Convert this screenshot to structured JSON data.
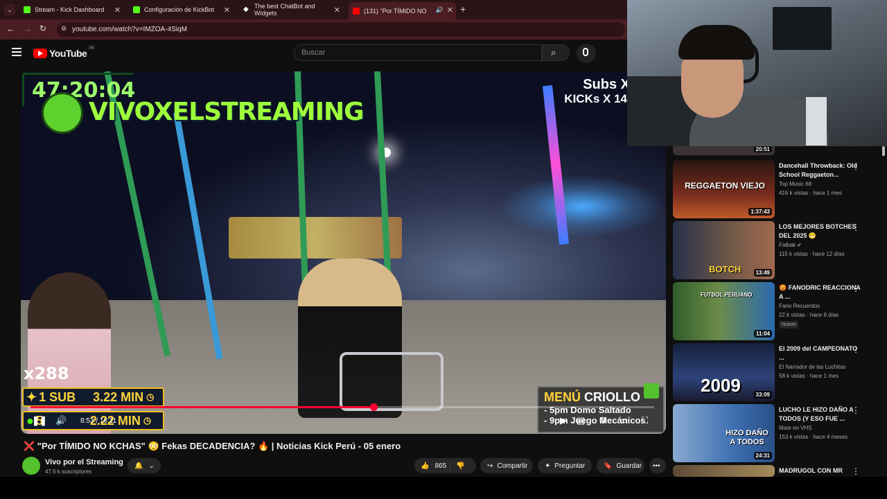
{
  "browser": {
    "tabs": [
      {
        "label": "Stream - Kick Dashboard",
        "icon": "kick-icon",
        "color": "#53fc18"
      },
      {
        "label": "Configuración de KickBot",
        "icon": "kickbot-icon",
        "color": "#53fc18"
      },
      {
        "label": "The best ChatBot and Widgets",
        "icon": "diamond-icon",
        "color": "#ffffff"
      },
      {
        "label": "(131) \"Por TÍMIDO NO",
        "icon": "youtube-icon",
        "color": "#ff0000",
        "active": true
      }
    ],
    "url": "youtube.com/watch?v=IMZOA-4SiqM"
  },
  "youtube": {
    "logo": "YouTube",
    "region": "PE",
    "search_placeholder": "Buscar"
  },
  "video": {
    "overlay_timer": "47:20:04",
    "overlay_channel": "VIVOXELSTREAMING",
    "subs_text": "Subs X",
    "kicks_text": "KICKs X 14",
    "multiplier": "x288",
    "sub_row1_left": "1 SUB",
    "sub_row1_right": "3.22 MIN",
    "sub_row2_left": "5",
    "sub_row2_right": "2.22 MIN",
    "menu_title_a": "MENÚ",
    "menu_title_b": "CRIOLLO",
    "menu_line1": "- 5pm Domo Saltado",
    "menu_line2": "- 9pm Juego Mecánicos",
    "current_time": "8:53",
    "duration": "16:11",
    "progress_fraction": 0.55
  },
  "info": {
    "title": "❌ \"Por TÍMIDO NO KCHAS\" 😳 Fekas DECADENCIA? 🔥 | Noticias Kick Perú - 05 enero",
    "channel": "Vivo por el Streaming",
    "subscribers": "47.5 k suscriptores",
    "likes": "865",
    "share": "Compartir",
    "ask": "Preguntar",
    "save": "Guardar"
  },
  "sidebar": [
    {
      "title": "Dancehall Throwback: Old School Reggaeton...",
      "channel": "Top Music 68",
      "meta": "416 k vistas · hace 1 mes",
      "duration": "1:37:43",
      "thumb_text": "REGGAETON VIEJO",
      "thumb_color": "#3a1b14"
    },
    {
      "title": "LOS MEJORES BOTCHES DEL 2025 😬",
      "channel": "Falbak ✔",
      "meta": "115 k vistas · hace 12 días",
      "duration": "13:49",
      "thumb_text": "BOTCH",
      "thumb_color": "#5c4a3e"
    },
    {
      "title": "😡 FANODRIC REACCIONA A ...",
      "channel": "Fano Recuerdos",
      "meta": "22 k vistas · hace 6 días",
      "duration": "11:04",
      "badge": "Nuevo",
      "thumb_text": "FUTBOL PERUANO",
      "thumb_color": "#3c5c2e"
    },
    {
      "title": "El 2009 del CAMPEONATO ...",
      "channel": "El Narrador de las Luchitas",
      "meta": "58 k vistas · hace 1 mes",
      "duration": "33:09",
      "thumb_text": "2009",
      "thumb_color": "#1f2a4a"
    },
    {
      "title": "LUCHO LE HIZO DAÑO A TODOS (Y ESO FUE ...",
      "channel": "Mate en VHS",
      "meta": "153 k vistas · hace 4 meses",
      "duration": "24:31",
      "thumb_text": "HIZO DAÑO A TODOS",
      "thumb_color": "#3d6fb1"
    },
    {
      "title": "MADRUGOL CON MR",
      "channel": "",
      "meta": "",
      "duration": "",
      "thumb_text": "",
      "thumb_color": "#44382a"
    }
  ],
  "top_partial_duration": "20:51"
}
